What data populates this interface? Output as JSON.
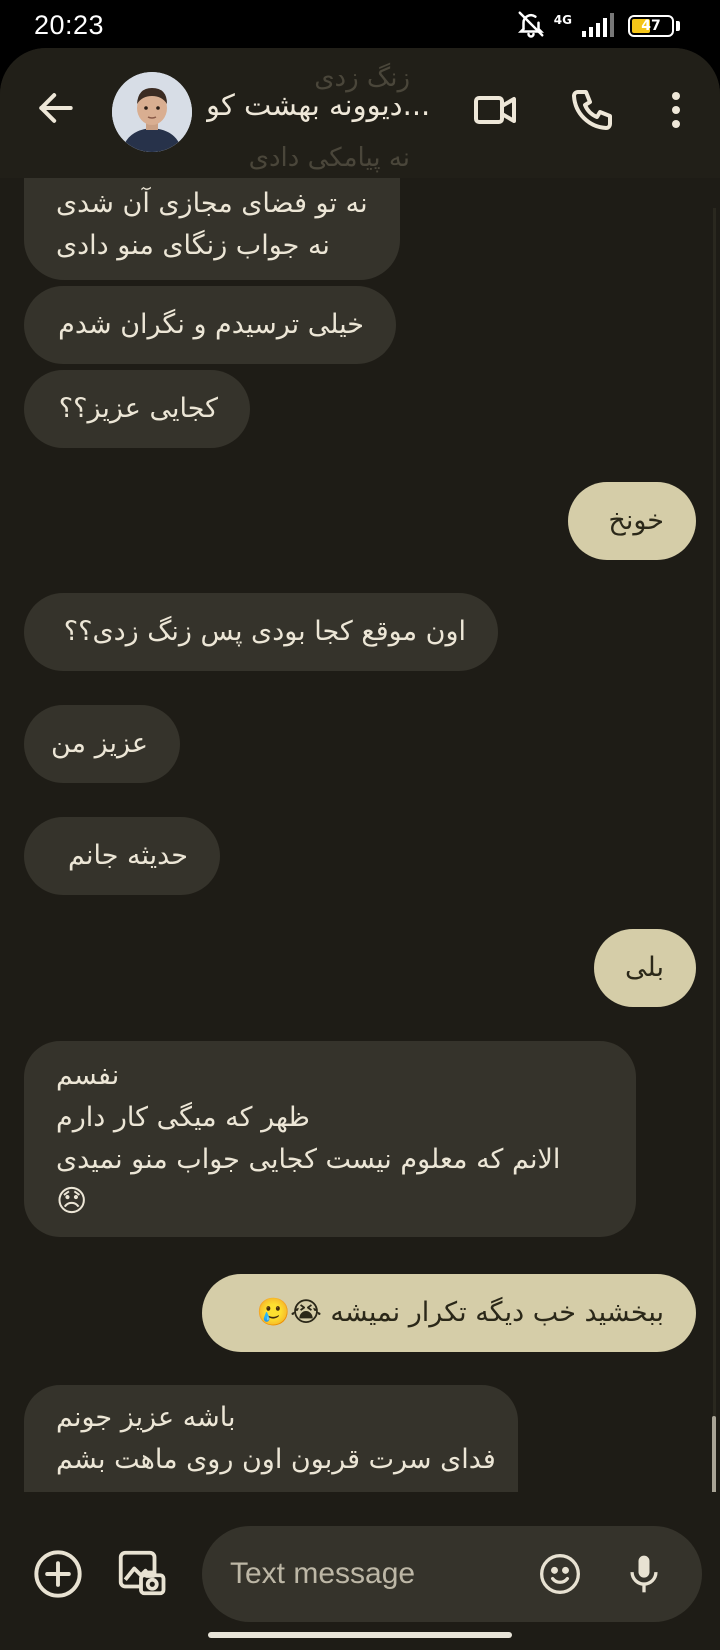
{
  "status_bar": {
    "time": "20:23",
    "network": "4G",
    "battery": "47",
    "icons": [
      "bell-off-icon",
      "signal-icon",
      "battery-icon"
    ]
  },
  "header": {
    "contact_name": "...ديوونه بهشت كو",
    "icons": [
      "back-arrow-icon",
      "video-call-icon",
      "phone-icon",
      "more-vert-icon"
    ]
  },
  "ghost_text": [
    "زنگ زدی",
    "نه پیامکی دادی"
  ],
  "messages": [
    {
      "dir": "in",
      "lines": [
        "نه تو فضای مجازی آن شدی",
        "نه جواب زنگای منو دادی"
      ]
    },
    {
      "dir": "in",
      "lines": [
        "خیلی ترسیدم و نگران شدم"
      ]
    },
    {
      "dir": "in",
      "lines": [
        "کجایی عزیز؟؟"
      ]
    },
    {
      "dir": "out",
      "lines": [
        "خونخ"
      ]
    },
    {
      "dir": "in",
      "lines": [
        "اون موقع کجا بودی پس زنگ زدی؟؟"
      ]
    },
    {
      "dir": "in",
      "lines": [
        "عزیز من"
      ]
    },
    {
      "dir": "in",
      "lines": [
        "حدیثه جانم"
      ]
    },
    {
      "dir": "out",
      "lines": [
        "بلی"
      ]
    },
    {
      "dir": "in",
      "lines": [
        "نفسم",
        "ظهر که میگی کار دارم",
        "الانم که معلوم نیست کجایی جواب منو نمیدی",
        "😞"
      ]
    },
    {
      "dir": "out",
      "lines": [
        "ببخشید خب دیگه تکرار نمیشه 😭🥲"
      ]
    },
    {
      "dir": "in",
      "lines": [
        "باشه عزیز جونم",
        "فدای سرت قربون اون روی ماهت بشم"
      ]
    }
  ],
  "composer": {
    "placeholder": "Text message",
    "icons": [
      "add-circle-icon",
      "gallery-icon",
      "emoji-icon",
      "mic-icon"
    ]
  },
  "colors": {
    "background": "#1e1c16",
    "incoming_bubble": "#35332b",
    "outgoing_bubble": "#d5cda8",
    "battery_fill": "#f5c518"
  }
}
